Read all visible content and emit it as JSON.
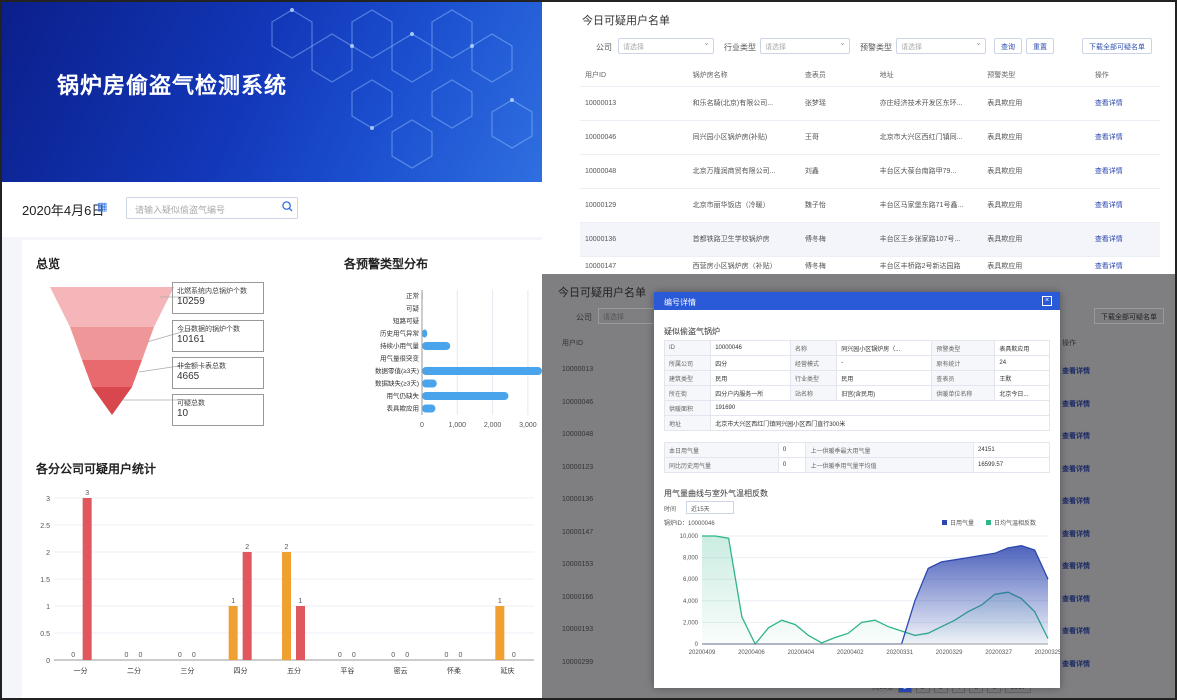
{
  "app": {
    "title": "锅炉房偷盗气检测系统"
  },
  "left": {
    "date": "2020年4月6日",
    "search_placeholder": "请输入疑似偷盗气编号",
    "overview": {
      "title": "总览",
      "items": [
        {
          "label": "北燃系统内总锅炉个数",
          "value": "10259"
        },
        {
          "label": "今日数据的锅炉个数",
          "value": "10161"
        },
        {
          "label": "非金额卡表总数",
          "value": "4665"
        },
        {
          "label": "可疑总数",
          "value": "10"
        }
      ]
    }
  },
  "alarm_chart": {
    "type": "bar",
    "title": "各预警类型分布",
    "categories": [
      "正常",
      "可疑",
      "短路可疑",
      "历史用气异常",
      "持续小用气量",
      "用气量很突变",
      "数据零值(≥3天)",
      "数据缺失(≥3天)",
      "用气仍缺失",
      "表具欺应用"
    ],
    "values": [
      20,
      0,
      0,
      150,
      800,
      0,
      3400,
      420,
      2450,
      380
    ],
    "xticks": [
      "0",
      "1,000",
      "2,000",
      "3,000"
    ],
    "xlim": [
      0,
      3400
    ]
  },
  "company_chart": {
    "type": "bar",
    "title": "各分公司可疑用户统计",
    "categories": [
      "一分",
      "二分",
      "三分",
      "四分",
      "五分",
      "平谷",
      "密云",
      "怀柔",
      "延庆"
    ],
    "series": [
      {
        "values": [
          0,
          0,
          0,
          1,
          2,
          0,
          0,
          0,
          1
        ]
      },
      {
        "values": [
          3,
          0,
          0,
          2,
          1,
          0,
          0,
          0,
          0
        ]
      }
    ],
    "ylim": [
      0,
      3
    ],
    "yticks": [
      "0",
      "0.5",
      "1",
      "1.5",
      "2",
      "2.5",
      "3"
    ],
    "colors": [
      "#f0a030",
      "#e0575e"
    ]
  },
  "suspect_list": {
    "title": "今日可疑用户名单",
    "filters": {
      "company": "公司",
      "industry": "行业类型",
      "warning": "预警类型",
      "placeholder": "请选择"
    },
    "buttons": {
      "query": "查询",
      "reset": "重置",
      "download": "下载全部可疑名单"
    },
    "columns": [
      "用户ID",
      "锅炉房名称",
      "查表员",
      "地址",
      "预警类型",
      "操作"
    ],
    "rows": [
      {
        "id": "10000013",
        "name": "和乐名騎(北京)有限公司...",
        "reader": "张梦瑶",
        "addr": "亦庄经济技术开发区东环...",
        "type": "表具欺应用",
        "op": "查看详情"
      },
      {
        "id": "10000046",
        "name": "同兴园小区锅炉房(补贴)",
        "reader": "王哥",
        "addr": "北京市大兴区西红门镇同...",
        "type": "表具欺应用",
        "op": "查看详情"
      },
      {
        "id": "10000048",
        "name": "北京万隆润商贸有限公司...",
        "reader": "刘鑫",
        "addr": "丰台区大葆台南路甲79...",
        "type": "表具欺应用",
        "op": "查看详情"
      },
      {
        "id": "10000129",
        "name": "北京市丽华饭店（冷暖）",
        "reader": "魏子怡",
        "addr": "丰台区马家堡东路71号鑫...",
        "type": "表具欺应用",
        "op": "查看详情"
      },
      {
        "id": "10000136",
        "name": "首都铁路卫生学校锅炉房",
        "reader": "傅冬梅",
        "addr": "丰台区王乡张家路107号...",
        "type": "表具欺应用",
        "op": "查看详情"
      },
      {
        "id": "10000147",
        "name": "西营房小区锅炉房（补贴）",
        "reader": "傅冬梅",
        "addr": "丰台区丰桥路2号新达园路",
        "type": "表具欺应用",
        "op": "查看详情"
      }
    ]
  },
  "dim_list": {
    "title": "今日可疑用户名单",
    "company": "公司",
    "placeholder": "请选择",
    "download": "下载全部可疑名单",
    "col_id": "用户ID",
    "col_op": "操作",
    "ids": [
      "10000013",
      "10000046",
      "10000048",
      "10000123",
      "10000136",
      "10000147",
      "10000153",
      "10000166",
      "10000193",
      "10000299"
    ],
    "op": "查看详情",
    "pagination": {
      "total_label": "共51条",
      "pages": [
        "1",
        "2",
        "3",
        "4",
        "5",
        "6",
        "1017"
      ]
    }
  },
  "modal": {
    "title": "编号详情",
    "subtitle": "疑似偷盗气锅炉",
    "info": [
      [
        "ID",
        "10000046",
        "名称",
        "同兴园小区锅炉房（...",
        "预警类型",
        "表具欺应用"
      ],
      [
        "所属公司",
        "四分",
        "经营模式",
        "-",
        "原有统计",
        "24"
      ],
      [
        "建筑类型",
        "民用",
        "行业类型",
        "民用",
        "查表员",
        "王默"
      ],
      [
        "所在街",
        "四分户内服务一所",
        "站名称",
        "旧宫(含民用)",
        "供暖单位名称",
        "北京今日..."
      ],
      [
        "供暖面积",
        "191690",
        "",
        "",
        "",
        ""
      ],
      [
        "地址",
        "北京市大兴区西红门镇同兴园小区西门直行300米",
        "",
        "",
        "",
        ""
      ]
    ],
    "stats": [
      [
        "本日用气量",
        "0",
        "上一供暖季最大用气量",
        "24151"
      ],
      [
        "同比历史用气量",
        "0",
        "上一供暖季用气量平均值",
        "16599.57"
      ]
    ],
    "line_chart": {
      "type": "line",
      "title": "用气量曲线与室外气温相反数",
      "range_label": "时间",
      "range_value": "近15天",
      "meter_label": "锅炉ID：10000046",
      "legend": [
        "日用气量",
        "日均气温相反数"
      ],
      "colors": [
        "#2e47b0",
        "#2fb58a"
      ],
      "x": [
        "20200409",
        "20200406",
        "20200404",
        "20200402",
        "20200331",
        "20200329",
        "20200327",
        "20200325"
      ],
      "yticks": [
        "0",
        "2,000",
        "4,000",
        "6,000",
        "8,000",
        "10,000"
      ],
      "ylim": [
        0,
        10000
      ],
      "series": [
        {
          "name": "日用气量",
          "values": [
            0,
            0,
            0,
            0,
            0,
            0,
            0,
            0,
            0,
            0,
            0,
            0,
            0,
            0,
            0,
            0,
            4000,
            7000,
            7600,
            7800,
            8000,
            8200,
            8400,
            8900,
            9100,
            8700,
            6000
          ]
        },
        {
          "name": "日均气温相反数",
          "values": [
            10000,
            10000,
            9800,
            2500,
            0,
            1500,
            2200,
            1800,
            800,
            100,
            600,
            1000,
            2000,
            2200,
            1600,
            1200,
            800,
            1000,
            1600,
            2200,
            3000,
            3600,
            4600,
            4800,
            4200,
            3000,
            500
          ]
        }
      ]
    }
  }
}
